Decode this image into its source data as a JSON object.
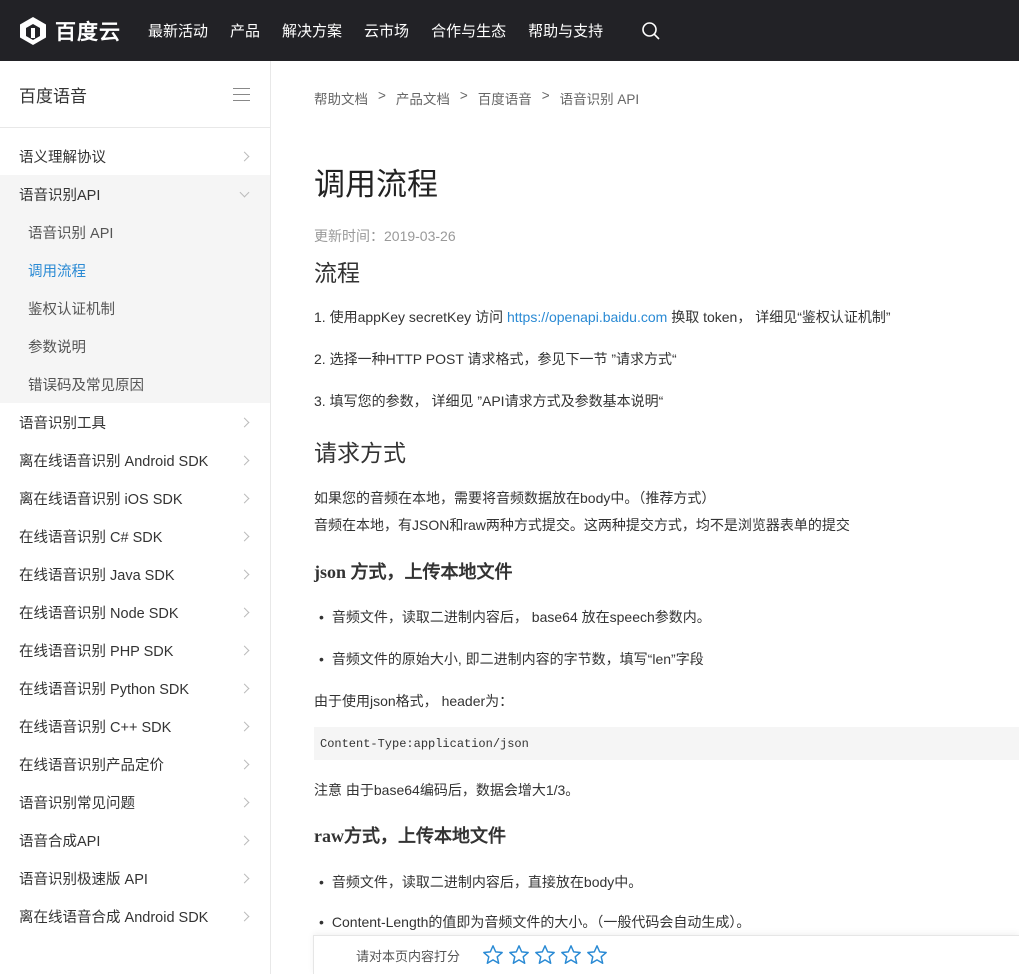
{
  "header": {
    "logo_text": "百度云",
    "nav": [
      "最新活动",
      "产品",
      "解决方案",
      "云市场",
      "合作与生态",
      "帮助与支持"
    ]
  },
  "sidebar": {
    "title": "百度语音",
    "items": [
      {
        "label": "语义理解协议"
      },
      {
        "label": "语音识别API",
        "open": true,
        "children": [
          "语音识别 API",
          "调用流程",
          "鉴权认证机制",
          "参数说明",
          "错误码及常见原因"
        ]
      },
      {
        "label": "语音识别工具"
      },
      {
        "label": "离在线语音识别 Android SDK"
      },
      {
        "label": "离在线语音识别 iOS SDK"
      },
      {
        "label": "在线语音识别 C# SDK"
      },
      {
        "label": "在线语音识别 Java SDK"
      },
      {
        "label": "在线语音识别 Node SDK"
      },
      {
        "label": "在线语音识别 PHP SDK"
      },
      {
        "label": "在线语音识别 Python SDK"
      },
      {
        "label": "在线语音识别 C++ SDK"
      },
      {
        "label": "在线语音识别产品定价"
      },
      {
        "label": "语音识别常见问题"
      },
      {
        "label": "语音合成API"
      },
      {
        "label": "语音识别极速版 API"
      },
      {
        "label": "离在线语音合成 Android SDK"
      }
    ],
    "active_child": "调用流程"
  },
  "breadcrumb": [
    "帮助文档",
    "产品文档",
    "百度语音",
    "语音识别 API"
  ],
  "breadcrumb_sep": ">",
  "article": {
    "title": "调用流程",
    "updated": "更新时间：2019-03-26",
    "sec1_title": "流程",
    "step1_pre": "1.  使用appKey secretKey 访问 ",
    "step1_link": "https://openapi.baidu.com",
    "step1_post": " 换取 token， 详细见“鉴权认证机制”",
    "step2": "2.  选择一种HTTP POST 请求格式，参见下一节 ”请求方式“",
    "step3": "3.  填写您的参数， 详细见 ”API请求方式及参数基本说明“",
    "sec2_title": "请求方式",
    "req_p1": "如果您的音频在本地，需要将音频数据放在body中。（推荐方式）",
    "req_p2": "音频在本地，有JSON和raw两种方式提交。这两种提交方式，均不是浏览器表单的提交",
    "json_title": "json 方式，上传本地文件",
    "json_b1": "音频文件，读取二进制内容后， base64 放在speech参数内。",
    "json_b2": "音频文件的原始大小, 即二进制内容的字节数，填写“len”字段",
    "json_header": "由于使用json格式， header为：",
    "code": "Content-Type:application/json",
    "note": "注意 由于base64编码后，数据会增大1/3。",
    "raw_title": "raw方式，上传本地文件",
    "raw_b1": "音频文件，读取二进制内容后，直接放在body中。",
    "raw_b2": "Content-Length的值即为音频文件的大小。（一般代码会自动生成）。"
  },
  "rating": {
    "label": "请对本页内容打分",
    "stars": 5
  },
  "colors": {
    "topbar": "#222226",
    "link": "#2a8ad4",
    "star": "#2a8ad4"
  }
}
